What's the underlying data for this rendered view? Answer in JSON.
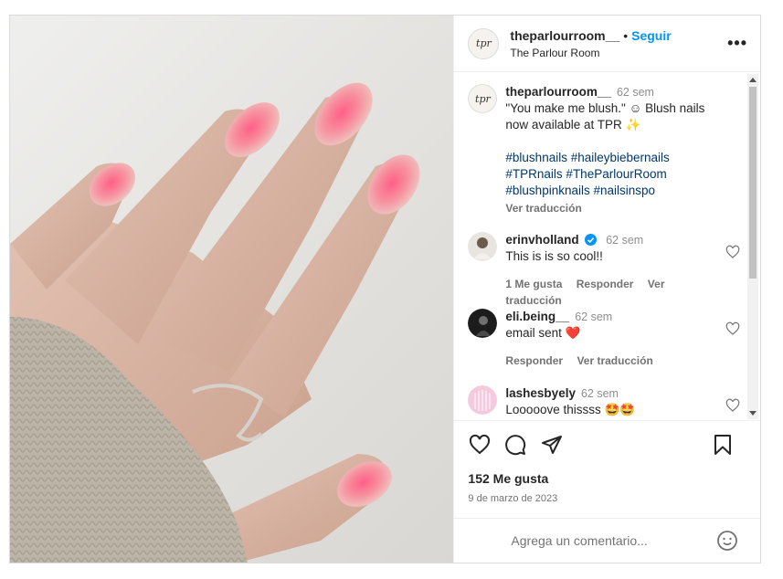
{
  "header": {
    "avatar_text": "tpr",
    "username": "theparlourroom__",
    "separator": "•",
    "follow_label": "Seguir",
    "subtitle": "The Parlour Room",
    "more_icon": "more-horizontal-icon"
  },
  "caption": {
    "avatar_text": "tpr",
    "username": "theparlourroom__",
    "time": "62 sem",
    "line1": "\"You make me blush.\" ☺ Blush nails",
    "line2": "now available at TPR ✨",
    "hashtags1": "#blushnails #haileybiebernails",
    "hashtags2": "#TPRnails #TheParlourRoom",
    "hashtags3": "#blushpinknails #nailsinspo",
    "translate": "Ver traducción"
  },
  "comments": [
    {
      "username": "erinvholland",
      "verified": true,
      "time": "62 sem",
      "text": "This is is so cool!!",
      "likes": "1 Me gusta",
      "reply": "Responder",
      "translate": "Ver traducción"
    },
    {
      "username": "eli.being__",
      "time": "62 sem",
      "text": "email sent ❤️",
      "reply": "Responder",
      "translate": "Ver traducción"
    },
    {
      "username": "lashesbyely",
      "time": "62 sem",
      "text": "Looooove thissss 🤩🤩"
    }
  ],
  "footer": {
    "likes": "152 Me gusta",
    "date": "9 de marzo de 2023",
    "add_comment_placeholder": "Agrega un comentario...",
    "icons": [
      "heart-icon",
      "comment-icon",
      "share-icon",
      "bookmark-icon",
      "emoji-icon"
    ]
  },
  "colors": {
    "link_blue": "#0095f6",
    "hashtag": "#00376b",
    "muted": "#737373",
    "heart_red": "#e0245e"
  }
}
